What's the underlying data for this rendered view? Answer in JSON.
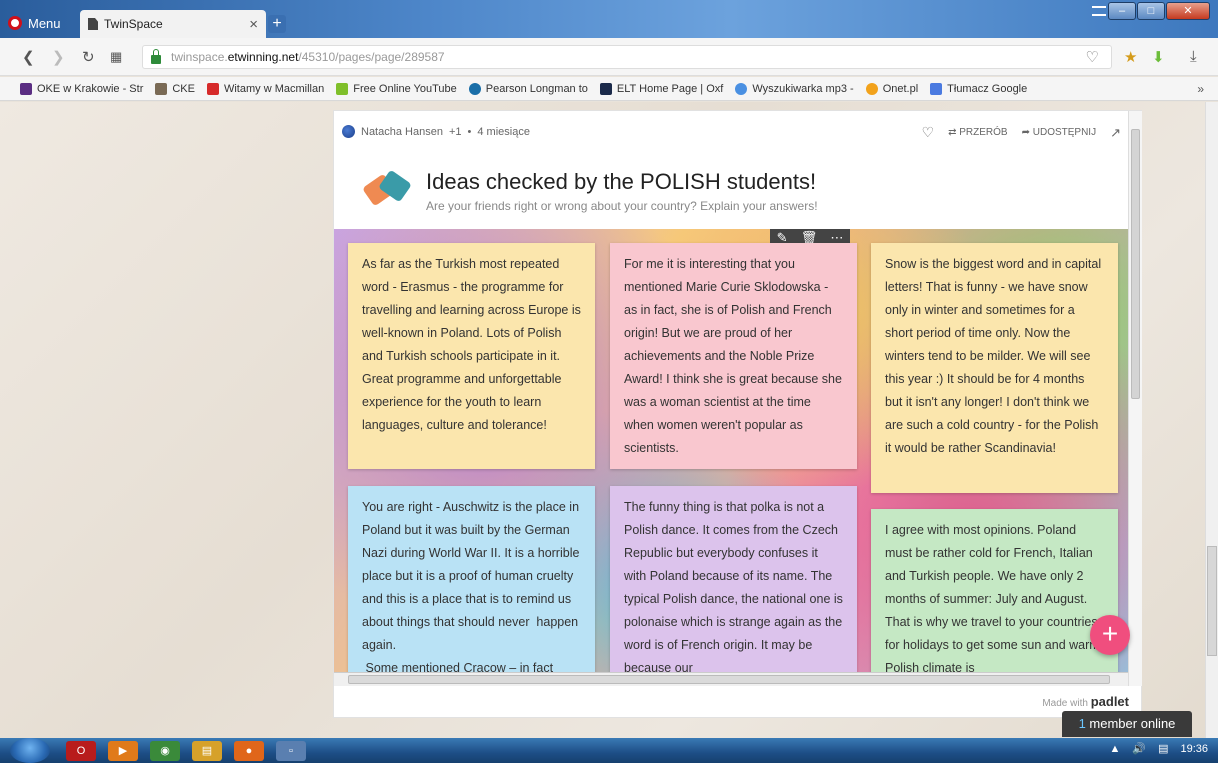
{
  "browser": {
    "menu_label": "Menu",
    "tab_title": "TwinSpace",
    "tab_close": "×",
    "new_tab": "+",
    "url_prefix": "twinspace.",
    "url_domain": "etwinning.net",
    "url_path": "/45310/pages/page/289587"
  },
  "bookmarks": [
    {
      "label": "OKE w Krakowie - Str",
      "color": "#5a2d82"
    },
    {
      "label": "CKE",
      "color": "#7a6a55"
    },
    {
      "label": "Witamy w Macmillan",
      "color": "#d62a2a"
    },
    {
      "label": "Free Online YouTube",
      "color": "#7fbf2a"
    },
    {
      "label": "Pearson Longman to",
      "color": "#1a6ea8"
    },
    {
      "label": "ELT Home Page | Oxf",
      "color": "#1b2a4a"
    },
    {
      "label": "Wyszukiwarka mp3 -",
      "color": "#4a90e2"
    },
    {
      "label": "Onet.pl",
      "color": "#f2a21b"
    },
    {
      "label": "Tłumacz Google",
      "color": "#4a7ae0"
    }
  ],
  "padlet": {
    "author": "Natacha Hansen",
    "plus": "+1",
    "time": "4 miesiące",
    "action_remake": "PRZERÓB",
    "action_share": "UDOSTĘPNIJ",
    "title": "Ideas checked by the POLISH students!",
    "subtitle": "Are your friends right or wrong about your country? Explain your answers!",
    "made_with": "Made with",
    "brand": "padlet"
  },
  "notes": [
    {
      "color": "yellow",
      "text": "As far as the Turkish most repeated word - Erasmus - the programme for travelling and learning across Europe is well-known in Poland. Lots of Polish and Turkish schools participate in it. Great programme and unforgettable experience for the youth to learn languages, culture and tolerance!"
    },
    {
      "color": "pink",
      "text": "For me it is interesting that you mentioned Marie Curie Sklodowska - as in fact, she is of Polish and French origin! But we are proud of her achievements and the Noble Prize Award! I think she is great because she was a woman scientist at the time when women weren't popular as scientists."
    },
    {
      "color": "yellow",
      "text": "Snow is the biggest word and in capital letters! That is funny - we have snow only in winter and sometimes for a short period of time only. Now the winters tend to be milder. We will see this year :) It should be for 4 months but it isn't any longer! I don't think we are such a cold country - for the Polish it would be rather Scandinavia!"
    },
    {
      "color": "blue",
      "text": "You are right - Auschwitz is the place in Poland but it was built by the German Nazi during World War II. It is a horrible place but it is a proof of human cruelty and this is a place that is to remind us about things that should never  happen again.\n Some mentioned Cracow – in fact"
    },
    {
      "color": "purple",
      "text": "The funny thing is that polka is not a Polish dance. It comes from the Czech Republic but everybody confuses it with Poland because of its name. The typical Polish dance, the national one is polonaise which is strange again as the word is of French origin. It may be because our"
    },
    {
      "color": "green",
      "text": "I agree with most opinions. Poland must be rather cold for French, Italian and Turkish people. We have only 2 months of summer: July and August. That is why we travel to your countries for holidays to get some sun and warm. Polish climate is"
    }
  ],
  "fab_label": "+",
  "member_online": {
    "count": "1",
    "label": "member online"
  },
  "taskbar": {
    "time": "19:36"
  }
}
